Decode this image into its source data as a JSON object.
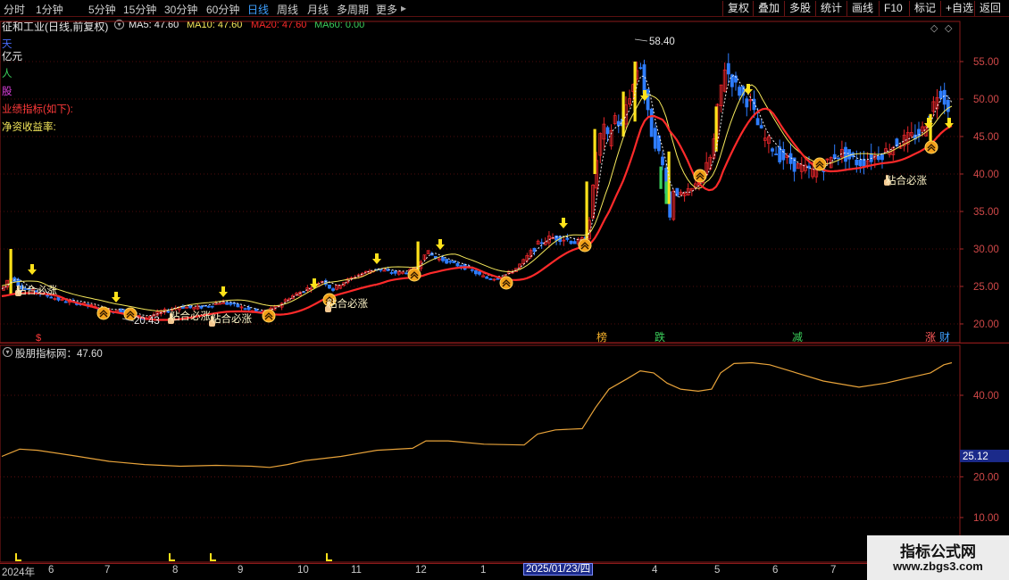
{
  "toolbar": {
    "timeframes": [
      "分时",
      "1分钟",
      "5分钟",
      "15分钟",
      "30分钟",
      "60分钟",
      "日线",
      "周线",
      "月线",
      "多周期",
      "更多"
    ],
    "active_timeframe": "日线",
    "more_arrow": "▸",
    "right_buttons": [
      "复权",
      "叠加",
      "多股",
      "统计",
      "画线",
      "F10",
      "标记",
      "+自选",
      "返回"
    ]
  },
  "chart_header": {
    "title": "征和工业(日线,前复权)",
    "ma5": "MA5: 47.60",
    "ma10": "MA10: 47.60",
    "ma20": "MA20: 47.60",
    "ma60": "MA60: 0.00"
  },
  "left_labels": {
    "tian": "天",
    "yiyuan": "亿元",
    "ren": "人",
    "gu": "股",
    "yeji": "业绩指标(如下):",
    "jzc": "净资收益率:"
  },
  "chart_data": [
    {
      "type": "line",
      "name": "main-price-chart",
      "y_ticks": [
        "55.00",
        "50.00",
        "45.00",
        "40.00",
        "35.00",
        "30.00",
        "25.00",
        "20.00"
      ],
      "ylim": [
        18.5,
        58.8
      ],
      "x_months": [
        "2024年",
        "6",
        "7",
        "8",
        "9",
        "10",
        "11",
        "12",
        "1",
        "2025/01/23/四",
        "4",
        "5",
        "6",
        "7"
      ],
      "price_path": [
        [
          0,
          24.5
        ],
        [
          6,
          25.8
        ],
        [
          12,
          26.2
        ],
        [
          20,
          25.0
        ],
        [
          30,
          24.6
        ],
        [
          40,
          24.2
        ],
        [
          55,
          23.6
        ],
        [
          70,
          23.0
        ],
        [
          85,
          22.8
        ],
        [
          100,
          22.4
        ],
        [
          110,
          22.0
        ],
        [
          120,
          21.6
        ],
        [
          130,
          21.9
        ],
        [
          140,
          21.5
        ],
        [
          150,
          21.0
        ],
        [
          160,
          20.8
        ],
        [
          170,
          21.2
        ],
        [
          180,
          21.6
        ],
        [
          190,
          22.0
        ],
        [
          200,
          22.3
        ],
        [
          215,
          22.1
        ],
        [
          230,
          22.4
        ],
        [
          245,
          22.9
        ],
        [
          260,
          22.5
        ],
        [
          275,
          21.9
        ],
        [
          290,
          21.5
        ],
        [
          300,
          21.8
        ],
        [
          310,
          22.5
        ],
        [
          320,
          23.4
        ],
        [
          330,
          24.0
        ],
        [
          340,
          24.6
        ],
        [
          350,
          25.2
        ],
        [
          360,
          25.8
        ],
        [
          370,
          24.5
        ],
        [
          380,
          25.4
        ],
        [
          390,
          26.0
        ],
        [
          400,
          26.6
        ],
        [
          410,
          27.0
        ],
        [
          420,
          27.3
        ],
        [
          430,
          27.0
        ],
        [
          440,
          26.8
        ],
        [
          455,
          26.9
        ],
        [
          465,
          27.5
        ],
        [
          475,
          29.8
        ],
        [
          485,
          28.8
        ],
        [
          495,
          28.5
        ],
        [
          505,
          28.0
        ],
        [
          515,
          27.7
        ],
        [
          525,
          27.2
        ],
        [
          535,
          26.5
        ],
        [
          545,
          26.0
        ],
        [
          555,
          26.2
        ],
        [
          565,
          26.6
        ],
        [
          575,
          27.3
        ],
        [
          585,
          28.5
        ],
        [
          595,
          30.0
        ],
        [
          605,
          31.0
        ],
        [
          615,
          31.5
        ],
        [
          625,
          31.5
        ],
        [
          635,
          31.2
        ],
        [
          645,
          30.8
        ],
        [
          655,
          31.5
        ],
        [
          660,
          36.0
        ],
        [
          665,
          41.0
        ],
        [
          670,
          45.0
        ],
        [
          675,
          46.0
        ],
        [
          680,
          44.0
        ],
        [
          685,
          48.0
        ],
        [
          690,
          47.0
        ],
        [
          695,
          46.0
        ],
        [
          700,
          50.0
        ],
        [
          705,
          51.0
        ],
        [
          710,
          53.0
        ],
        [
          714,
          56.0
        ],
        [
          718,
          52.0
        ],
        [
          722,
          49.0
        ],
        [
          726,
          46.0
        ],
        [
          730,
          45.0
        ],
        [
          735,
          43.0
        ],
        [
          740,
          41.0
        ],
        [
          744,
          38.0
        ],
        [
          748,
          34.0
        ],
        [
          752,
          38.0
        ],
        [
          756,
          37.5
        ],
        [
          762,
          37.0
        ],
        [
          768,
          37.5
        ],
        [
          774,
          38.0
        ],
        [
          780,
          39.0
        ],
        [
          786,
          40.0
        ],
        [
          792,
          41.5
        ],
        [
          797,
          44.0
        ],
        [
          802,
          49.0
        ],
        [
          806,
          52.0
        ],
        [
          810,
          54.5
        ],
        [
          815,
          53.0
        ],
        [
          820,
          52.0
        ],
        [
          826,
          51.0
        ],
        [
          832,
          50.0
        ],
        [
          838,
          49.5
        ],
        [
          845,
          47.0
        ],
        [
          852,
          45.0
        ],
        [
          860,
          44.0
        ],
        [
          870,
          42.5
        ],
        [
          880,
          41.8
        ],
        [
          890,
          41.0
        ],
        [
          900,
          40.5
        ],
        [
          910,
          40.2
        ],
        [
          918,
          41.0
        ],
        [
          925,
          41.5
        ],
        [
          932,
          42.5
        ],
        [
          940,
          42.8
        ],
        [
          950,
          42.0
        ],
        [
          960,
          41.5
        ],
        [
          970,
          42.0
        ],
        [
          980,
          42.5
        ],
        [
          990,
          43.0
        ],
        [
          1000,
          44.0
        ],
        [
          1010,
          44.5
        ],
        [
          1020,
          45.0
        ],
        [
          1030,
          45.5
        ],
        [
          1035,
          47.0
        ],
        [
          1040,
          48.0
        ],
        [
          1045,
          50.0
        ],
        [
          1050,
          51.5
        ],
        [
          1055,
          50.0
        ],
        [
          1060,
          49.0
        ],
        [
          1064,
          47.6
        ]
      ],
      "annotations": {
        "high_label": "58.40",
        "low_label": "20.43",
        "signal_text": "粘合必涨",
        "events": [
          "$",
          "榜",
          "跌",
          "减",
          "涨",
          "财"
        ]
      }
    },
    {
      "type": "line",
      "name": "sub-indicator",
      "title": "股朋指标网：47.60",
      "y_ticks": [
        "40.00",
        "20.00",
        "10.00"
      ],
      "ylim": [
        5.0,
        50.0
      ],
      "current_value_label": "25.12",
      "values_path": [
        [
          0,
          25.0
        ],
        [
          20,
          26.8
        ],
        [
          40,
          26.5
        ],
        [
          80,
          25.2
        ],
        [
          120,
          23.8
        ],
        [
          160,
          23.0
        ],
        [
          200,
          22.6
        ],
        [
          240,
          22.8
        ],
        [
          280,
          22.6
        ],
        [
          300,
          22.3
        ],
        [
          320,
          23.0
        ],
        [
          340,
          24.0
        ],
        [
          380,
          25.0
        ],
        [
          420,
          26.5
        ],
        [
          460,
          27.0
        ],
        [
          475,
          28.8
        ],
        [
          500,
          28.8
        ],
        [
          540,
          28.0
        ],
        [
          585,
          27.8
        ],
        [
          600,
          30.5
        ],
        [
          620,
          31.5
        ],
        [
          650,
          31.8
        ],
        [
          665,
          37.0
        ],
        [
          680,
          41.5
        ],
        [
          700,
          44.0
        ],
        [
          715,
          46.0
        ],
        [
          730,
          45.5
        ],
        [
          745,
          43.0
        ],
        [
          760,
          41.5
        ],
        [
          780,
          41.0
        ],
        [
          795,
          41.5
        ],
        [
          805,
          45.5
        ],
        [
          820,
          47.8
        ],
        [
          840,
          48.0
        ],
        [
          860,
          47.5
        ],
        [
          890,
          45.5
        ],
        [
          920,
          43.5
        ],
        [
          960,
          42.0
        ],
        [
          990,
          43.0
        ],
        [
          1020,
          44.5
        ],
        [
          1040,
          45.5
        ],
        [
          1055,
          47.5
        ],
        [
          1064,
          48.0
        ]
      ]
    }
  ],
  "date_axis": {
    "labels": [
      "2024年",
      "6",
      "7",
      "8",
      "9",
      "10",
      "11",
      "12",
      "1",
      "4",
      "5",
      "6",
      "7"
    ],
    "highlight_date": "2025/01/23/四"
  },
  "watermark": {
    "line1": "指标公式网",
    "line2": "www.zbgs3.com"
  },
  "colors": {
    "up": "#e8262a",
    "down": "#2e7dff",
    "ma5": "#f0f0f0",
    "ma10": "#f5e85b",
    "ma20": "#ff2a2a",
    "ma60": "#3bd05b",
    "indicator_line": "#e8a33a",
    "signal_yellow": "#ffe21a",
    "border_red": "#8a1a1a"
  },
  "icons": [
    "down-arrow-icon",
    "golden-coin-icon",
    "hand-pointer-icon",
    "settings-circle-icon",
    "diamond-icon"
  ]
}
